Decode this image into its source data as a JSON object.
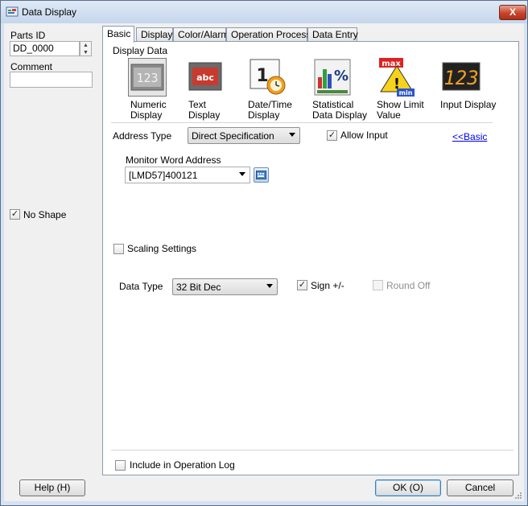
{
  "window": {
    "title": "Data Display",
    "close_label": "X"
  },
  "left": {
    "parts_id_label": "Parts ID",
    "parts_id_value": "DD_0000",
    "comment_label": "Comment",
    "comment_value": "",
    "no_shape_label": "No Shape",
    "no_shape_checked": true
  },
  "tabs": [
    {
      "label": "Basic",
      "active": true
    },
    {
      "label": "Display",
      "active": false
    },
    {
      "label": "Color/Alarm",
      "active": false
    },
    {
      "label": "Operation Process",
      "active": false
    },
    {
      "label": "Data Entry",
      "active": false
    }
  ],
  "basic": {
    "display_data_label": "Display Data",
    "display_types": [
      {
        "line1": "Numeric",
        "line2": "Display",
        "icon": "numeric-display-icon",
        "selected": true
      },
      {
        "line1": "Text",
        "line2": "Display",
        "icon": "text-display-icon",
        "selected": false
      },
      {
        "line1": "Date/Time",
        "line2": "Display",
        "icon": "date-time-display-icon",
        "selected": false
      },
      {
        "line1": "Statistical",
        "line2": "Data Display",
        "icon": "statistical-display-icon",
        "selected": false
      },
      {
        "line1": "Show Limit",
        "line2": "Value",
        "icon": "show-limit-value-icon",
        "selected": false
      },
      {
        "line1": "Input Display",
        "line2": "",
        "icon": "input-display-icon",
        "selected": false
      }
    ],
    "address_type_label": "Address Type",
    "address_type_value": "Direct Specification",
    "allow_input_label": "Allow Input",
    "allow_input_checked": true,
    "basic_link": "<<Basic",
    "monitor_word_address_label": "Monitor Word Address",
    "monitor_word_address_value": "[LMD57]400121",
    "scaling_settings_label": "Scaling Settings",
    "scaling_checked": false,
    "data_type_label": "Data Type",
    "data_type_value": "32 Bit Dec",
    "sign_label": "Sign +/-",
    "sign_checked": true,
    "round_off_label": "Round Off",
    "round_off_checked": false,
    "include_log_label": "Include in Operation Log",
    "include_log_checked": false
  },
  "footer": {
    "help_label": "Help (H)",
    "ok_label": "OK (O)",
    "cancel_label": "Cancel"
  },
  "colors": {
    "titlebar": "#c5d6ec",
    "close": "#c7442a",
    "link": "#0000ee"
  }
}
